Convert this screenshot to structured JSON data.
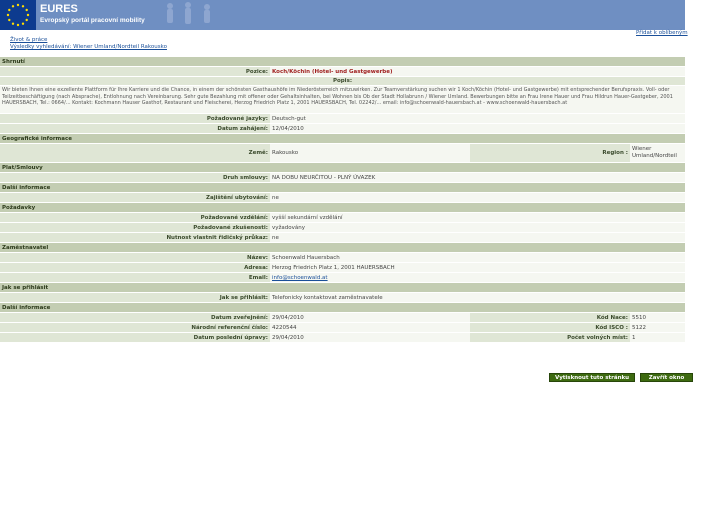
{
  "banner": {
    "brand": "EURES",
    "subtitle": "Evropský portál pracovní mobility"
  },
  "links": {
    "life_work": "Život & práce",
    "breadcrumb": "Výsledky vyhledávání: Wiener Umland/Nordteil Rakousko",
    "add_favorites": "Přidat k oblíbeným"
  },
  "sections": {
    "summary": "Shrnutí",
    "geo": "Geografické informace",
    "pay": "Plat/Smlouvy",
    "more": "Další informace",
    "req": "Požadavky",
    "employer": "Zaměstnavatel",
    "apply": "Jak se přihlásit",
    "more2": "Další informace"
  },
  "summary": {
    "position_label": "Pozice:",
    "position_value": "Koch/Köchin (Hotel- und Gastgewerbe)",
    "desc_label": "Popis:",
    "description": "Wir bieten Ihnen eine exzellente Plattform für Ihre Karriere und die Chance, in einem der schönsten Gasthaushöfe im Niederösterreich mitzuwirken. Zur Teamverstärkung suchen wir 1 Koch/Köchin (Hotel- und Gastgewerbe) mit entsprechender Berufspraxis. Voll- oder Teilzeitbeschäftigung (nach Absprache), Entlohnung nach Vereinbarung. Sehr gute Bezahlung mit offener oder Gehaltsinhalten, bei Wohnen bis Ob der Stadt Hollabrunn / Wiener Umland. Bewerbungen bitte an Frau Irene Hauer und Frau Hildrun Hauer-Gastgeber, 2001 HAUERSBACH, Tel.: 0664/... Kontakt: Kochmann Hauser Gasthof, Restaurant und Fleischerei, Herzog Friedrich Platz 1, 2001 HAUERSBACH, Tel. 02242/... email: info@schoenwald-hauersbach.at - www.schoenwald-hauersbach.at",
    "lang_label": "Požadované jazyky:",
    "lang_value": "Deutsch-gut",
    "start_label": "Datum zahájení:",
    "start_value": "12/04/2010"
  },
  "geo": {
    "country_label": "Země:",
    "country_value": "Rakousko",
    "region_label": "Region :",
    "region_value": "Wiener Umland/Nordteil"
  },
  "pay": {
    "contract_label": "Druh smlouvy:",
    "contract_value": "NA DOBU NEURČITOU - PLNÝ ÚVAZEK"
  },
  "more": {
    "accom_label": "Zajištění ubytování:",
    "accom_value": "ne"
  },
  "req": {
    "edu_label": "Požadované vzdělání:",
    "edu_value": "vyšší sekundární vzdělání",
    "exp_label": "Požadované zkušenosti:",
    "exp_value": "vyžadovány",
    "lic_label": "Nutnost vlastnit řidičský průkaz:",
    "lic_value": "ne"
  },
  "employer": {
    "name_label": "Název:",
    "name_value": "Schoenwald Hauersbach",
    "addr_label": "Adresa:",
    "addr_value": "Herzog Friedrich Platz 1, 2001 HAUERSBACH",
    "email_label": "Email:",
    "email_value": "info@schoenwald.at"
  },
  "apply": {
    "how_label": "Jak se přihlásit:",
    "how_value": "Telefonicky kontaktovat zaměstnavatele"
  },
  "more2": {
    "pub_label": "Datum zveřejnění:",
    "pub_value": "29/04/2010",
    "nace_label": "Kód Nace:",
    "nace_value": "5510",
    "ref_label": "Národní referenční číslo:",
    "ref_value": "4220544",
    "isco_label": "Kód ISCO :",
    "isco_value": "5122",
    "upd_label": "Datum poslední úpravy:",
    "upd_value": "29/04/2010",
    "pos_label": "Počet volných míst:",
    "pos_value": "1"
  },
  "buttons": {
    "print": "Vytisknout tuto stránku",
    "close": "Zavřít okno"
  },
  "colors": {
    "banner": "#6f8fc2",
    "section": "#c3cdb2",
    "label": "#dfe6d5",
    "value": "#f5f7f1",
    "button": "#3d6a10"
  }
}
